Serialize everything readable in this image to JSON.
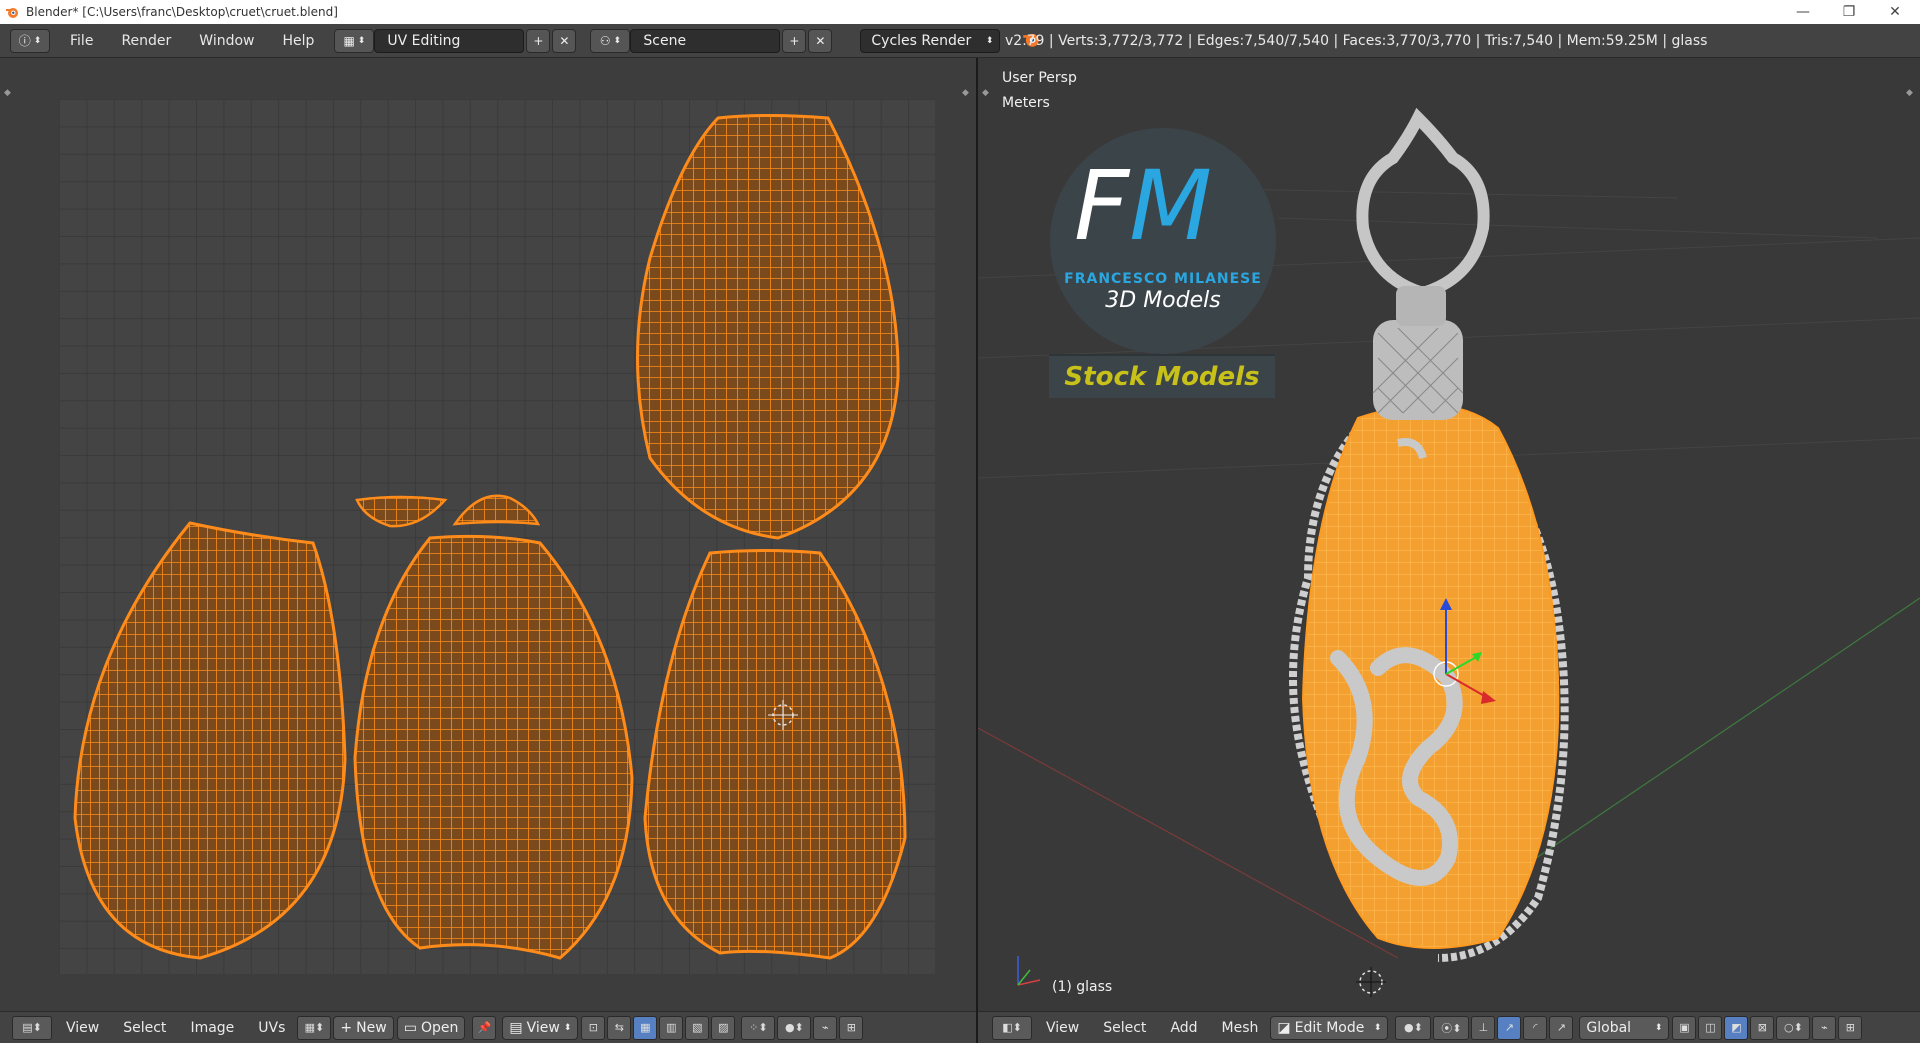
{
  "window": {
    "title": "Blender* [C:\\Users\\franc\\Desktop\\cruet\\cruet.blend]",
    "minimize": "—",
    "maximize": "❐",
    "close": "✕"
  },
  "menu": {
    "file": "File",
    "render": "Render",
    "window": "Window",
    "help": "Help"
  },
  "screen_layout": {
    "value": "UV Editing"
  },
  "scene": {
    "value": "Scene"
  },
  "engine": {
    "value": "Cycles Render"
  },
  "stats": "v2.79 | Verts:3,772/3,772 | Edges:7,540/7,540 | Faces:3,770/3,770 | Tris:7,540 | Mem:59.25M | glass",
  "viewport": {
    "persp": "User Persp",
    "units": "Meters",
    "object": "(1) glass"
  },
  "logo": {
    "letters": "FM",
    "name": "FRANCESCO MILANESE",
    "tagline": "3D Models",
    "stock": "Stock Models"
  },
  "uv_header": {
    "view": "View",
    "select": "Select",
    "image": "Image",
    "uvs": "UVs",
    "new": "New",
    "open": "Open",
    "view2": "View"
  },
  "v3d_header": {
    "view": "View",
    "select": "Select",
    "add": "Add",
    "mesh": "Mesh",
    "mode": "Edit Mode",
    "orientation": "Global"
  },
  "colors": {
    "uv_orange": "#ff8c1a",
    "bottle_fill": "#f4a030",
    "silver": "#c9c9c9",
    "stock_text": "#c7c11a",
    "fm_white": "#ffffff",
    "fm_blue": "#2aa6e0"
  }
}
